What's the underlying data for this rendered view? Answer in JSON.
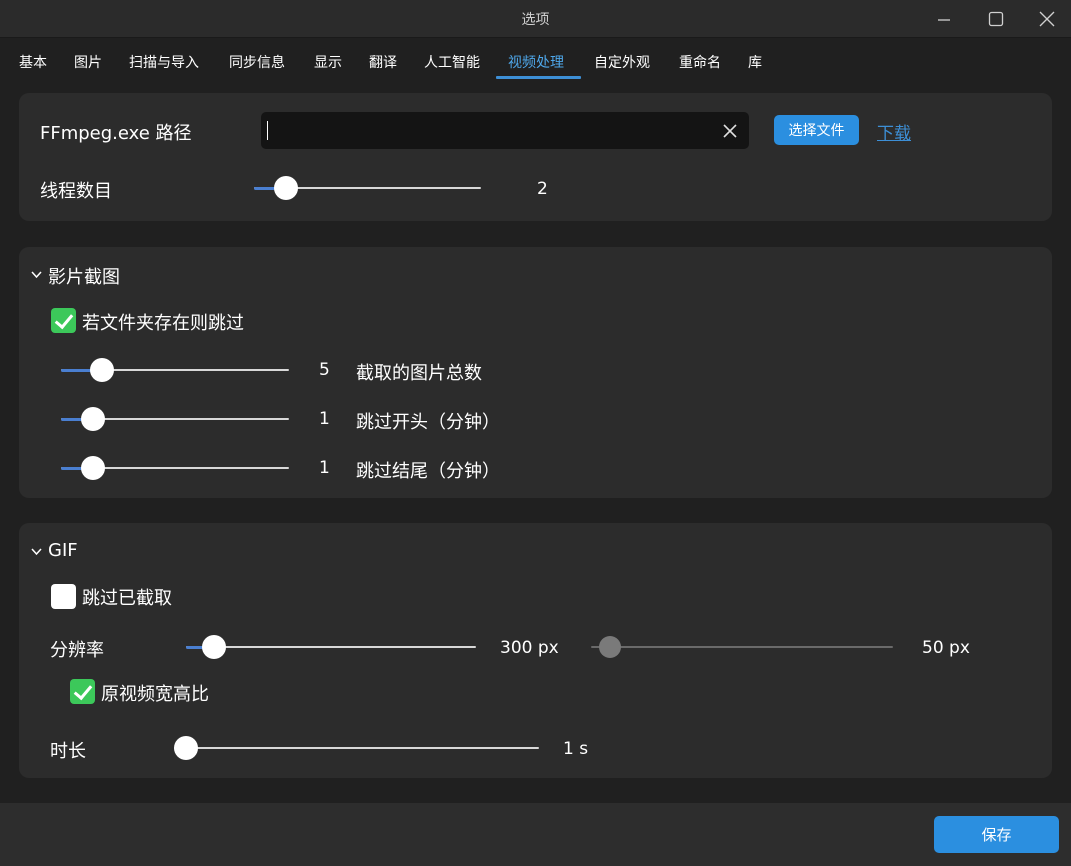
{
  "window": {
    "title": "选项"
  },
  "tabs": [
    {
      "label": "基本"
    },
    {
      "label": "图片"
    },
    {
      "label": "扫描与导入"
    },
    {
      "label": "同步信息"
    },
    {
      "label": "显示"
    },
    {
      "label": "翻译"
    },
    {
      "label": "人工智能"
    },
    {
      "label": "视频处理"
    },
    {
      "label": "自定外观"
    },
    {
      "label": "重命名"
    },
    {
      "label": "库"
    }
  ],
  "active_tab": "视频处理",
  "ffmpeg": {
    "label": "FFmpeg.exe 路径",
    "path_value": "",
    "pick_button": "选择文件",
    "download_link": "下载",
    "threads_label": "线程数目",
    "threads_value": "2",
    "threads_fraction": 0.1
  },
  "screenshot": {
    "title": "影片截图",
    "skip_existing_label": "若文件夹存在则跳过",
    "skip_existing_checked": true,
    "sliders": [
      {
        "value": "5",
        "label": "截取的图片总数",
        "fraction": 0.14
      },
      {
        "value": "1",
        "label": "跳过开头（分钟）",
        "fraction": 0.1
      },
      {
        "value": "1",
        "label": "跳过结尾（分钟）",
        "fraction": 0.1
      }
    ]
  },
  "gif": {
    "title": "GIF",
    "skip_captured_label": "跳过已截取",
    "skip_captured_checked": false,
    "resolution_label": "分辨率",
    "width_value": "300 px",
    "width_fraction": 0.06,
    "height_value": "50 px",
    "height_fraction": 0.03,
    "keep_aspect_label": "原视频宽高比",
    "keep_aspect_checked": true,
    "duration_label": "时长",
    "duration_value": "1 s",
    "duration_fraction": 0.0
  },
  "footer": {
    "save_label": "保存"
  },
  "colors": {
    "accent": "#2b8fe0",
    "check_green": "#3cc85a",
    "card_bg": "#2c2c2c",
    "window_bg": "#202020"
  }
}
